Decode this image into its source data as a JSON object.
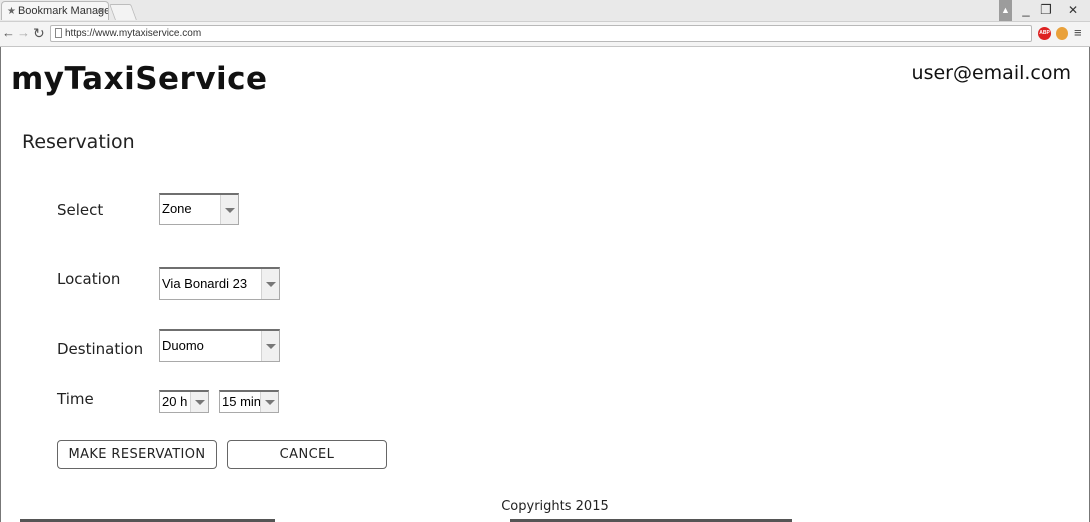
{
  "browser": {
    "tab_title": "Bookmark Manager",
    "tab_close": "×",
    "url": "https://www.mytaxiservice.com",
    "abp_label": "ABP"
  },
  "header": {
    "brand": "myTaxiService",
    "user_email": "user@email.com"
  },
  "form": {
    "title": "Reservation",
    "select_label": "Select",
    "select_value": "Zone",
    "location_label": "Location",
    "location_value": "Via Bonardi 23",
    "destination_label": "Destination",
    "destination_value": "Duomo",
    "time_label": "Time",
    "hour_value": "20 h",
    "minute_value": "15 min",
    "submit_label": "MAKE RESERVATION",
    "cancel_label": "CANCEL"
  },
  "footer": {
    "text": "Copyrights 2015"
  },
  "colors": {
    "page_bg": "#ffffff",
    "text": "#222222",
    "chrome_bg": "#e9e9e9"
  }
}
